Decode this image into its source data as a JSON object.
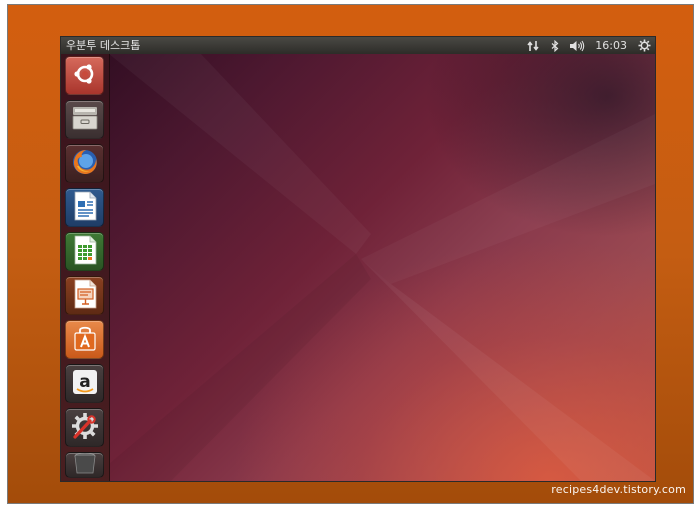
{
  "topbar": {
    "title": "우분투 데스크톱",
    "clock": "16:03"
  },
  "launcher": {
    "items": [
      {
        "name": "dash-home",
        "icon": "ubuntu-logo-icon",
        "color": "#c2483a"
      },
      {
        "name": "files",
        "icon": "file-cabinet-icon",
        "color": "#8a8a86"
      },
      {
        "name": "firefox",
        "icon": "firefox-icon",
        "color": "#c0392b"
      },
      {
        "name": "libreoffice-writer",
        "icon": "writer-document-icon",
        "color": "#2e6fb4"
      },
      {
        "name": "libreoffice-calc",
        "icon": "calc-spreadsheet-icon",
        "color": "#3f9a2f"
      },
      {
        "name": "libreoffice-impress",
        "icon": "impress-presentation-icon",
        "color": "#d35f22"
      },
      {
        "name": "software-center",
        "icon": "shopping-bag-icon",
        "color": "#e0691f"
      },
      {
        "name": "amazon",
        "icon": "amazon-logo-icon",
        "color": "#777777"
      },
      {
        "name": "system-settings",
        "icon": "settings-gear-wrench-icon",
        "color": "#6a6a6a"
      },
      {
        "name": "trash",
        "icon": "trash-can-icon",
        "color": "#5a5a5a"
      }
    ]
  },
  "watermark": "recipes4dev.tistory.com",
  "colors": {
    "frame_orange": "#d35e0f",
    "topbar": "#3a3935",
    "wallpaper_start": "#2c0c20",
    "wallpaper_end": "#b75a48"
  }
}
